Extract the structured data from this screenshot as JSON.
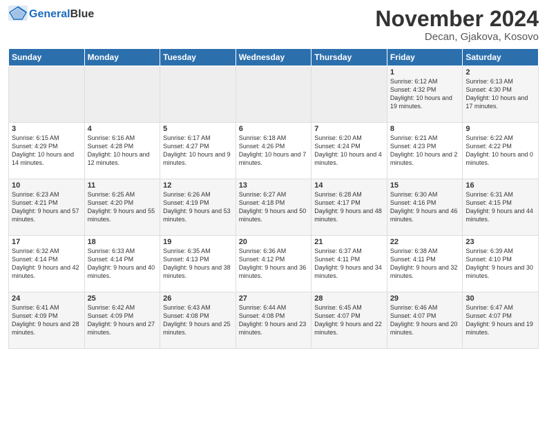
{
  "logo": {
    "line1": "General",
    "line2": "Blue"
  },
  "title": "November 2024",
  "location": "Decan, Gjakova, Kosovo",
  "weekdays": [
    "Sunday",
    "Monday",
    "Tuesday",
    "Wednesday",
    "Thursday",
    "Friday",
    "Saturday"
  ],
  "weeks": [
    [
      {
        "day": "",
        "text": ""
      },
      {
        "day": "",
        "text": ""
      },
      {
        "day": "",
        "text": ""
      },
      {
        "day": "",
        "text": ""
      },
      {
        "day": "",
        "text": ""
      },
      {
        "day": "1",
        "text": "Sunrise: 6:12 AM\nSunset: 4:32 PM\nDaylight: 10 hours and 19 minutes."
      },
      {
        "day": "2",
        "text": "Sunrise: 6:13 AM\nSunset: 4:30 PM\nDaylight: 10 hours and 17 minutes."
      }
    ],
    [
      {
        "day": "3",
        "text": "Sunrise: 6:15 AM\nSunset: 4:29 PM\nDaylight: 10 hours and 14 minutes."
      },
      {
        "day": "4",
        "text": "Sunrise: 6:16 AM\nSunset: 4:28 PM\nDaylight: 10 hours and 12 minutes."
      },
      {
        "day": "5",
        "text": "Sunrise: 6:17 AM\nSunset: 4:27 PM\nDaylight: 10 hours and 9 minutes."
      },
      {
        "day": "6",
        "text": "Sunrise: 6:18 AM\nSunset: 4:26 PM\nDaylight: 10 hours and 7 minutes."
      },
      {
        "day": "7",
        "text": "Sunrise: 6:20 AM\nSunset: 4:24 PM\nDaylight: 10 hours and 4 minutes."
      },
      {
        "day": "8",
        "text": "Sunrise: 6:21 AM\nSunset: 4:23 PM\nDaylight: 10 hours and 2 minutes."
      },
      {
        "day": "9",
        "text": "Sunrise: 6:22 AM\nSunset: 4:22 PM\nDaylight: 10 hours and 0 minutes."
      }
    ],
    [
      {
        "day": "10",
        "text": "Sunrise: 6:23 AM\nSunset: 4:21 PM\nDaylight: 9 hours and 57 minutes."
      },
      {
        "day": "11",
        "text": "Sunrise: 6:25 AM\nSunset: 4:20 PM\nDaylight: 9 hours and 55 minutes."
      },
      {
        "day": "12",
        "text": "Sunrise: 6:26 AM\nSunset: 4:19 PM\nDaylight: 9 hours and 53 minutes."
      },
      {
        "day": "13",
        "text": "Sunrise: 6:27 AM\nSunset: 4:18 PM\nDaylight: 9 hours and 50 minutes."
      },
      {
        "day": "14",
        "text": "Sunrise: 6:28 AM\nSunset: 4:17 PM\nDaylight: 9 hours and 48 minutes."
      },
      {
        "day": "15",
        "text": "Sunrise: 6:30 AM\nSunset: 4:16 PM\nDaylight: 9 hours and 46 minutes."
      },
      {
        "day": "16",
        "text": "Sunrise: 6:31 AM\nSunset: 4:15 PM\nDaylight: 9 hours and 44 minutes."
      }
    ],
    [
      {
        "day": "17",
        "text": "Sunrise: 6:32 AM\nSunset: 4:14 PM\nDaylight: 9 hours and 42 minutes."
      },
      {
        "day": "18",
        "text": "Sunrise: 6:33 AM\nSunset: 4:14 PM\nDaylight: 9 hours and 40 minutes."
      },
      {
        "day": "19",
        "text": "Sunrise: 6:35 AM\nSunset: 4:13 PM\nDaylight: 9 hours and 38 minutes."
      },
      {
        "day": "20",
        "text": "Sunrise: 6:36 AM\nSunset: 4:12 PM\nDaylight: 9 hours and 36 minutes."
      },
      {
        "day": "21",
        "text": "Sunrise: 6:37 AM\nSunset: 4:11 PM\nDaylight: 9 hours and 34 minutes."
      },
      {
        "day": "22",
        "text": "Sunrise: 6:38 AM\nSunset: 4:11 PM\nDaylight: 9 hours and 32 minutes."
      },
      {
        "day": "23",
        "text": "Sunrise: 6:39 AM\nSunset: 4:10 PM\nDaylight: 9 hours and 30 minutes."
      }
    ],
    [
      {
        "day": "24",
        "text": "Sunrise: 6:41 AM\nSunset: 4:09 PM\nDaylight: 9 hours and 28 minutes."
      },
      {
        "day": "25",
        "text": "Sunrise: 6:42 AM\nSunset: 4:09 PM\nDaylight: 9 hours and 27 minutes."
      },
      {
        "day": "26",
        "text": "Sunrise: 6:43 AM\nSunset: 4:08 PM\nDaylight: 9 hours and 25 minutes."
      },
      {
        "day": "27",
        "text": "Sunrise: 6:44 AM\nSunset: 4:08 PM\nDaylight: 9 hours and 23 minutes."
      },
      {
        "day": "28",
        "text": "Sunrise: 6:45 AM\nSunset: 4:07 PM\nDaylight: 9 hours and 22 minutes."
      },
      {
        "day": "29",
        "text": "Sunrise: 6:46 AM\nSunset: 4:07 PM\nDaylight: 9 hours and 20 minutes."
      },
      {
        "day": "30",
        "text": "Sunrise: 6:47 AM\nSunset: 4:07 PM\nDaylight: 9 hours and 19 minutes."
      }
    ]
  ]
}
